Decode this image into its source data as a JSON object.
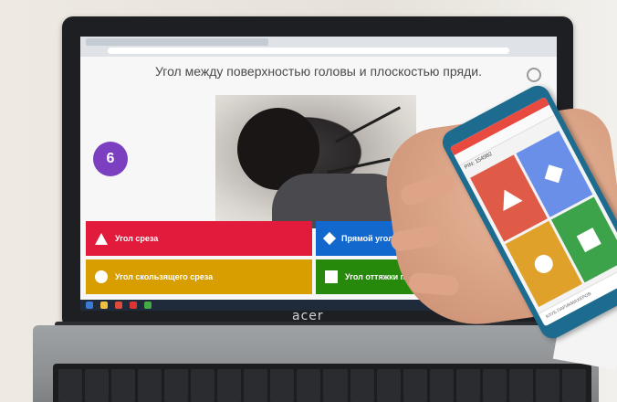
{
  "screen": {
    "question": "Угол между поверхностью головы и плоскостью пряди.",
    "timer": "6",
    "answers": [
      {
        "label": "Угол среза",
        "shape": "triangle-icon",
        "color": "#e21b3c"
      },
      {
        "label": "Прямой угол",
        "shape": "diamond-icon",
        "color": "#1368ce"
      },
      {
        "label": "Угол скользящего среза",
        "shape": "circle-icon",
        "color": "#d89e00"
      },
      {
        "label": "Угол оттяжки пряди",
        "shape": "square-icon",
        "color": "#26890c"
      }
    ]
  },
  "laptop": {
    "brand": "acer"
  },
  "phone": {
    "pin_label": "PIN: 154982",
    "footer_text": "КЛУБ ПАРИКМАХЕРОВ"
  }
}
